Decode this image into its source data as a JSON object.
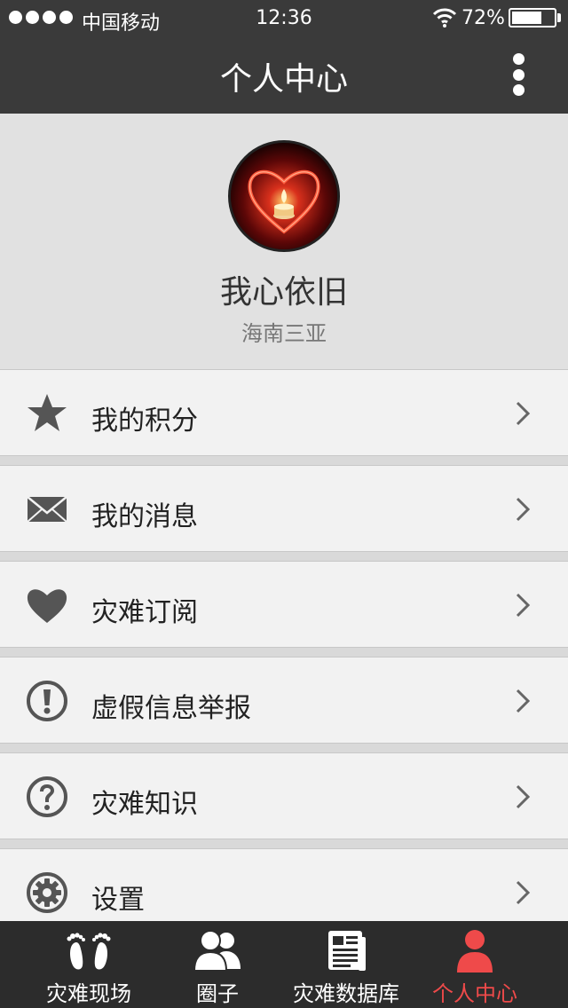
{
  "status_bar": {
    "carrier": "中国移动",
    "time": "12:36",
    "battery_percent": "72%",
    "battery_level": 0.72,
    "signal_dots": 4
  },
  "nav": {
    "title": "个人中心",
    "more_icon": "more-vertical-icon"
  },
  "profile": {
    "name": "我心依旧",
    "location": "海南三亚",
    "avatar_icon": "heart-candle-avatar"
  },
  "menu": [
    {
      "label": "我的积分",
      "icon": "star-icon"
    },
    {
      "label": "我的消息",
      "icon": "envelope-icon"
    },
    {
      "label": "灾难订阅",
      "icon": "heart-icon"
    },
    {
      "label": "虚假信息举报",
      "icon": "exclamation-circle-icon"
    },
    {
      "label": "灾难知识",
      "icon": "question-circle-icon"
    },
    {
      "label": "设置",
      "icon": "gear-icon"
    }
  ],
  "tabs": [
    {
      "label": "灾难现场",
      "icon": "footprints-icon",
      "active": false
    },
    {
      "label": "圈子",
      "icon": "group-icon",
      "active": false
    },
    {
      "label": "灾难数据库",
      "icon": "newspaper-icon",
      "active": false
    },
    {
      "label": "个人中心",
      "icon": "person-icon",
      "active": true
    }
  ],
  "colors": {
    "bar_dark": "#3a3a3a",
    "tabbar": "#2c2c2c",
    "active_tab": "#ef4a4a",
    "icon_gray": "#555555"
  }
}
